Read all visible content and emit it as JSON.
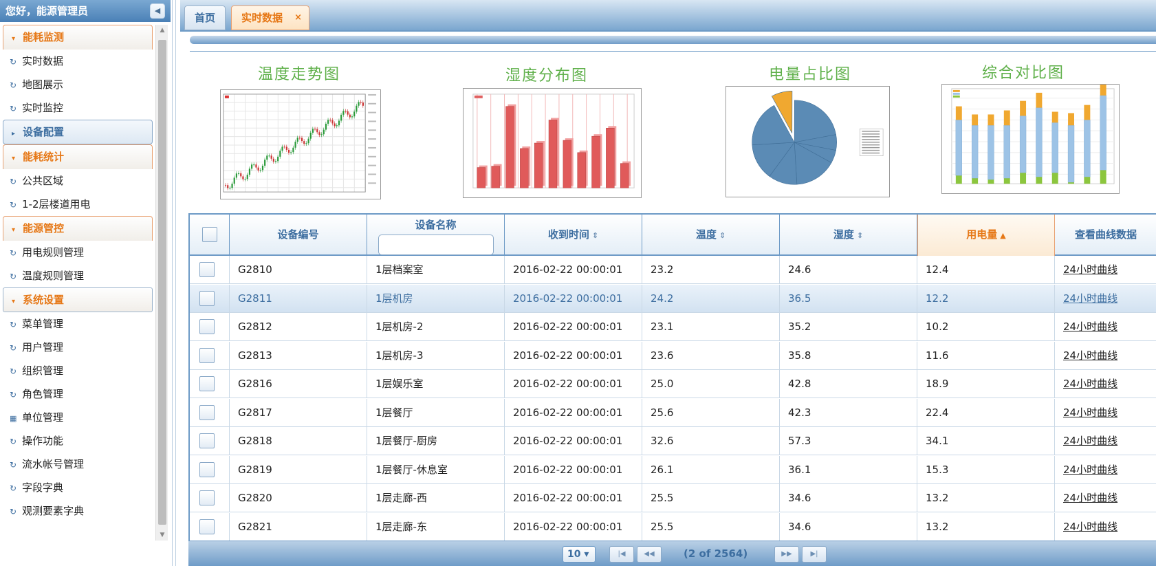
{
  "header": {
    "greeting": "您好，能源管理员"
  },
  "sidebar": {
    "groups": [
      {
        "title": "能耗监测",
        "items": [
          "实时数据",
          "地图展示",
          "实时监控"
        ]
      },
      {
        "title": "设备配置",
        "items": []
      },
      {
        "title": "能耗统计",
        "items": [
          "公共区域",
          "1-2层楼道用电"
        ]
      },
      {
        "title": "能源管控",
        "items": [
          "用电规则管理",
          "温度规则管理"
        ]
      },
      {
        "title": "系统设置",
        "items": [
          "菜单管理",
          "用户管理",
          "组织管理",
          "角色管理",
          "单位管理",
          "操作功能",
          "流水帐号管理",
          "字段字典",
          "观测要素字典"
        ]
      }
    ]
  },
  "tabs": {
    "home": "首页",
    "active": "实时数据",
    "close": "×"
  },
  "thumbnails": [
    {
      "title": "温度走势图"
    },
    {
      "title": "湿度分布图"
    },
    {
      "title": "电量占比图"
    },
    {
      "title": "综合对比图"
    }
  ],
  "grid": {
    "columns": [
      "设备编号",
      "设备名称",
      "收到时间",
      "温度",
      "湿度",
      "用电量",
      "查看曲线数据"
    ],
    "sort_icons": {
      "unsorted": "⇕",
      "ascending": "▲"
    },
    "rows": [
      [
        "G2810",
        "1层档案室",
        "2016-02-22 00:00:01",
        "23.2",
        "24.6",
        "12.4",
        "24小时曲线"
      ],
      [
        "G2811",
        "1层机房",
        "2016-02-22 00:00:01",
        "24.2",
        "36.5",
        "12.2",
        "24小时曲线"
      ],
      [
        "G2812",
        "1层机房-2",
        "2016-02-22 00:00:01",
        "23.1",
        "35.2",
        "10.2",
        "24小时曲线"
      ],
      [
        "G2813",
        "1层机房-3",
        "2016-02-22 00:00:01",
        "23.6",
        "35.8",
        "11.6",
        "24小时曲线"
      ],
      [
        "G2816",
        "1层娱乐室",
        "2016-02-22 00:00:01",
        "25.0",
        "42.8",
        "18.9",
        "24小时曲线"
      ],
      [
        "G2817",
        "1层餐厅",
        "2016-02-22 00:00:01",
        "25.6",
        "42.3",
        "22.4",
        "24小时曲线"
      ],
      [
        "G2818",
        "1层餐厅-厨房",
        "2016-02-22 00:00:01",
        "32.6",
        "57.3",
        "34.1",
        "24小时曲线"
      ],
      [
        "G2819",
        "1层餐厅-休息室",
        "2016-02-22 00:00:01",
        "26.1",
        "36.1",
        "15.3",
        "24小时曲线"
      ],
      [
        "G2820",
        "1层走廊-西",
        "2016-02-22 00:00:01",
        "25.5",
        "34.6",
        "13.2",
        "24小时曲线"
      ],
      [
        "G2821",
        "1层走廊-东",
        "2016-02-22 00:00:01",
        "25.5",
        "34.6",
        "13.2",
        "24小时曲线"
      ]
    ]
  },
  "paginator": {
    "rows_per_page": "10",
    "status": "(2 of 2564)"
  },
  "colors": {
    "accent_orange": "#e67817",
    "accent_blue": "#3d6ea0",
    "title_green": "#5fb04a"
  },
  "icons": [
    "collapse-left-icon",
    "refresh-icon",
    "grid-icon",
    "first-page-icon",
    "prev-page-icon",
    "next-page-icon",
    "last-page-icon"
  ]
}
